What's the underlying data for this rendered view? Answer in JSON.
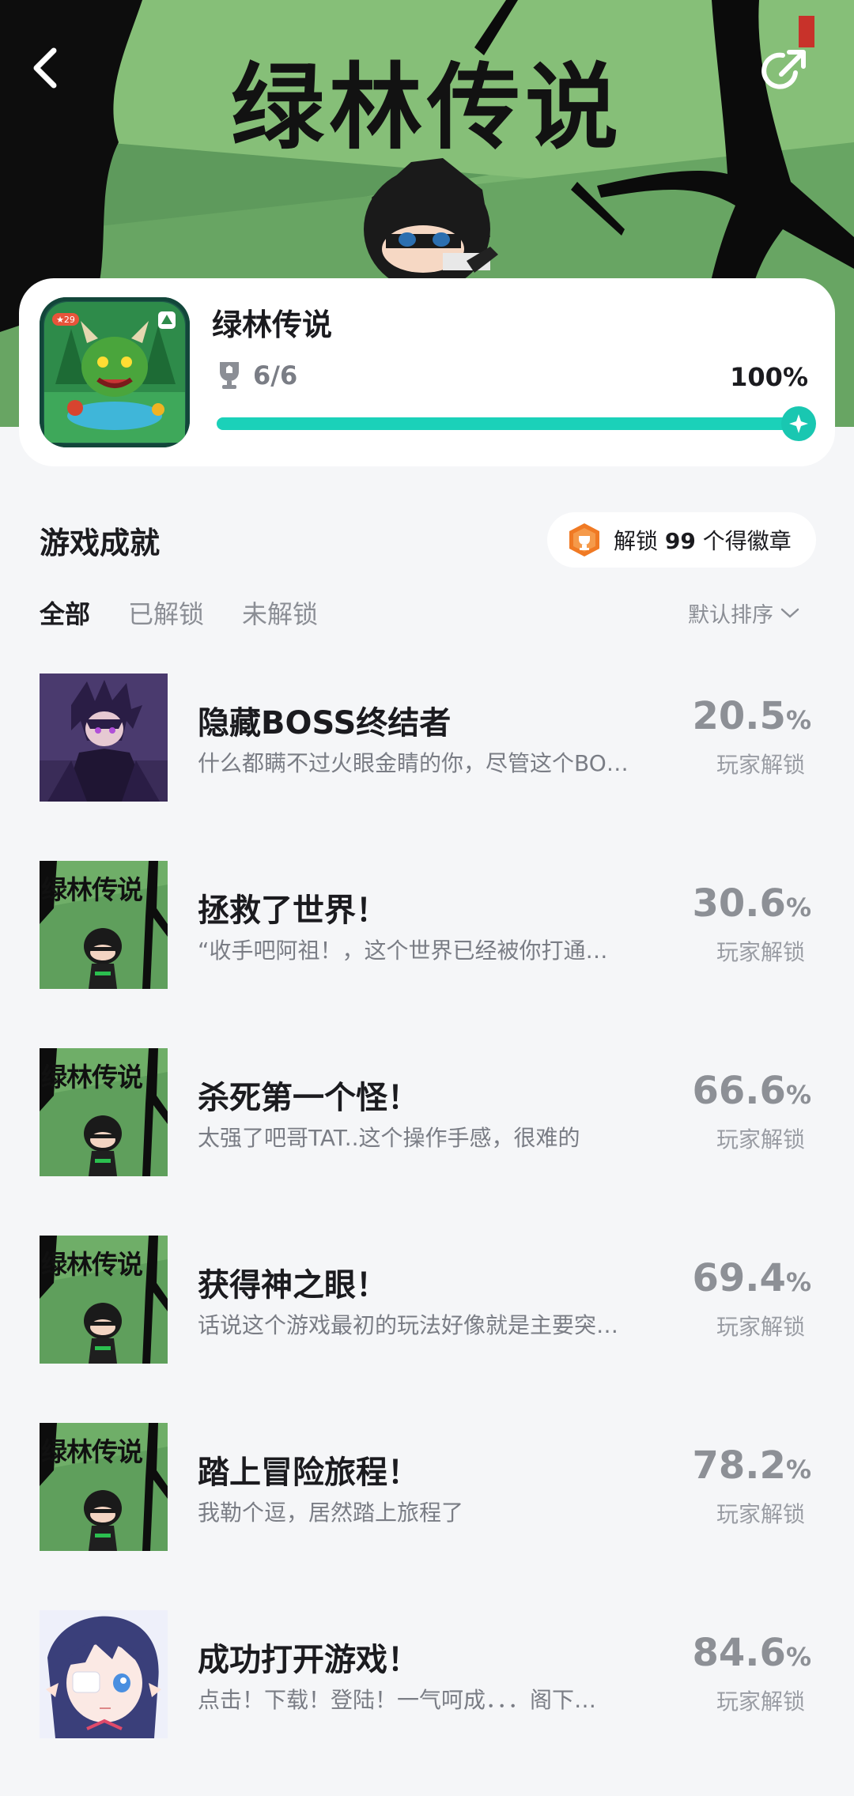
{
  "hero": {
    "title": "绿林传说"
  },
  "game": {
    "name": "绿林传说",
    "icon_badge": "29",
    "trophy": "6/6",
    "percent": "100%",
    "progress": 1.0
  },
  "section": {
    "title": "游戏成就",
    "badge_prefix": "解锁",
    "badge_count": "99",
    "badge_suffix": "个得徽章"
  },
  "tabs": [
    {
      "label": "全部",
      "active": true
    },
    {
      "label": "已解锁",
      "active": false
    },
    {
      "label": "未解锁",
      "active": false
    }
  ],
  "sort": {
    "label": "默认排序"
  },
  "achievements": [
    {
      "title": "隐藏BOSS终结者",
      "desc": "什么都瞒不过火眼金睛的你，尽管这个BO…",
      "rate": "20.5",
      "unit": "%",
      "rate_label": "玩家解锁",
      "thumb": "dark-knight",
      "thumb_text": ""
    },
    {
      "title": "拯救了世界！",
      "desc": "“收手吧阿祖！，这个世界已经被你打通…",
      "rate": "30.6",
      "unit": "%",
      "rate_label": "玩家解锁",
      "thumb": "game-cover",
      "thumb_text": "绿林传说"
    },
    {
      "title": "杀死第一个怪！",
      "desc": "太强了吧哥TAT..这个操作手感，很难的",
      "rate": "66.6",
      "unit": "%",
      "rate_label": "玩家解锁",
      "thumb": "game-cover",
      "thumb_text": "绿林传说"
    },
    {
      "title": "获得神之眼！",
      "desc": "话说这个游戏最初的玩法好像就是主要突…",
      "rate": "69.4",
      "unit": "%",
      "rate_label": "玩家解锁",
      "thumb": "game-cover",
      "thumb_text": "绿林传说"
    },
    {
      "title": "踏上冒险旅程！",
      "desc": "我勒个逗，居然踏上旅程了",
      "rate": "78.2",
      "unit": "%",
      "rate_label": "玩家解锁",
      "thumb": "game-cover",
      "thumb_text": "绿林传说"
    },
    {
      "title": "成功打开游戏！",
      "desc": "点击！下载！登陆！一气呵成．．．阁下…",
      "rate": "84.6",
      "unit": "%",
      "rate_label": "玩家解锁",
      "thumb": "anime-girl",
      "thumb_text": ""
    }
  ],
  "colors": {
    "accent": "#1bd1b9",
    "badge": "#f07a24",
    "background": "#f5f6f8"
  }
}
